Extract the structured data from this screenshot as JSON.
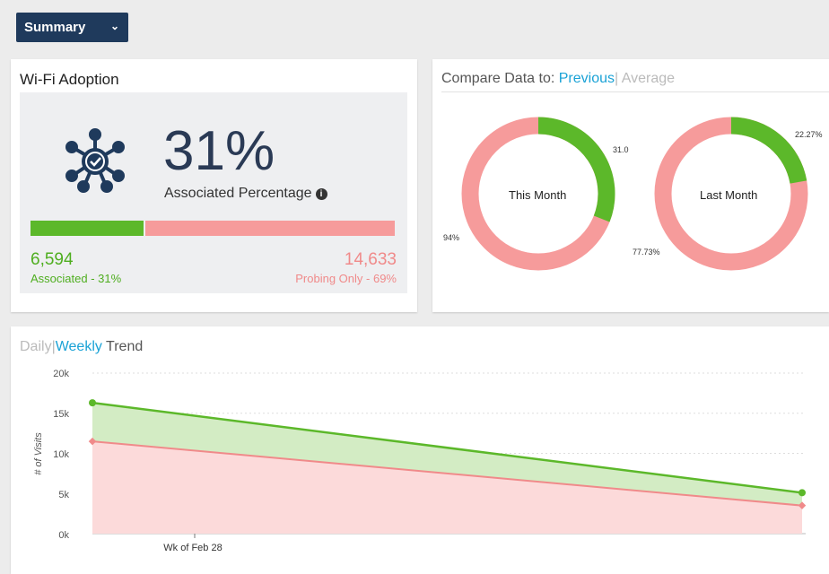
{
  "toolbar": {
    "summary_label": "Summary"
  },
  "wifi": {
    "title": "Wi-Fi Adoption",
    "percent": "31%",
    "associated_label": "Associated Percentage",
    "info_glyph": "i",
    "associated_count": "6,594",
    "associated_caption": "Associated - 31%",
    "probing_count": "14,633",
    "probing_caption": "Probing Only - 69%",
    "associated_fraction": 0.31,
    "colors": {
      "associated": "#5cb82a",
      "probing": "#f69b9b",
      "icon": "#1f3a5c"
    },
    "icon": "wifi-hub-icon"
  },
  "compare": {
    "prefix": "Compare Data to:",
    "option_active": "Previous",
    "separator": "|",
    "option_inactive": "Average",
    "this_month": {
      "label": "This Month",
      "green_value_text": "31.0",
      "red_value_text": "94%",
      "green_fraction": 0.31
    },
    "last_month": {
      "label": "Last Month",
      "green_value_text": "22.27%",
      "red_value_text": "77.73%",
      "green_fraction": 0.2227
    }
  },
  "trend": {
    "daily": "Daily",
    "separator": "|",
    "weekly": "Weekly",
    "trend": "Trend",
    "y_axis_title": "# of Visits",
    "y_ticks": [
      "20k",
      "15k",
      "10k",
      "5k",
      "0k"
    ],
    "x_tick": "Wk of Feb 28"
  },
  "chart_data": {
    "type": "area",
    "ylabel": "# of Visits",
    "ylim": [
      0,
      20000
    ],
    "series": [
      {
        "values": [
          16300,
          5100
        ],
        "color": "#5cb82a"
      },
      {
        "values": [
          11500,
          3500
        ],
        "color": "#f08a8a"
      }
    ]
  }
}
